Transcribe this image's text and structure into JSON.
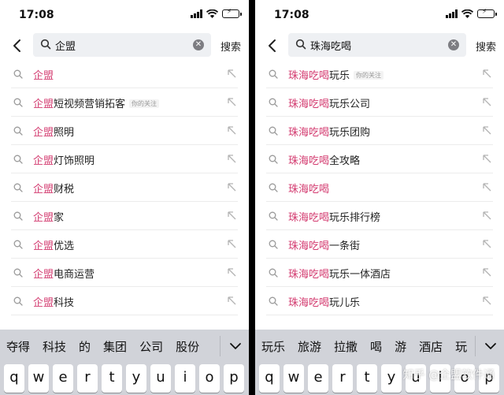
{
  "accent_color": "#d33a6f",
  "left": {
    "status": {
      "time": "17:08"
    },
    "search": {
      "query": "企盟",
      "submit_label": "搜索"
    },
    "suggestions": [
      {
        "highlight": "企盟",
        "rest": "",
        "tag": ""
      },
      {
        "highlight": "企盟",
        "rest": "短视频营销拓客",
        "tag": "你的关注"
      },
      {
        "highlight": "企盟",
        "rest": "照明",
        "tag": ""
      },
      {
        "highlight": "企盟",
        "rest": "灯饰照明",
        "tag": ""
      },
      {
        "highlight": "企盟",
        "rest": "财税",
        "tag": ""
      },
      {
        "highlight": "企盟",
        "rest": "家",
        "tag": ""
      },
      {
        "highlight": "企盟",
        "rest": "优选",
        "tag": ""
      },
      {
        "highlight": "企盟",
        "rest": "电商运营",
        "tag": ""
      },
      {
        "highlight": "企盟",
        "rest": "科技",
        "tag": ""
      }
    ],
    "candidates": [
      "夺得",
      "科技",
      "的",
      "集团",
      "公司",
      "股份"
    ],
    "keys": [
      "q",
      "w",
      "e",
      "r",
      "t",
      "y",
      "u",
      "i",
      "o",
      "p"
    ]
  },
  "right": {
    "status": {
      "time": "17:08"
    },
    "search": {
      "query": "珠海吃喝",
      "submit_label": "搜索"
    },
    "suggestions": [
      {
        "highlight": "珠海吃喝",
        "rest": "玩乐",
        "tag": "你的关注"
      },
      {
        "highlight": "珠海吃喝",
        "rest": "玩乐公司",
        "tag": ""
      },
      {
        "highlight": "珠海吃喝",
        "rest": "玩乐团购",
        "tag": ""
      },
      {
        "highlight": "珠海吃喝",
        "rest": "全攻略",
        "tag": ""
      },
      {
        "highlight": "珠海吃喝",
        "rest": "",
        "tag": ""
      },
      {
        "highlight": "珠海吃喝",
        "rest": "玩乐排行榜",
        "tag": ""
      },
      {
        "highlight": "珠海吃喝",
        "rest": "一条街",
        "tag": ""
      },
      {
        "highlight": "珠海吃喝",
        "rest": "玩乐一体酒店",
        "tag": ""
      },
      {
        "highlight": "珠海吃喝",
        "rest": "玩儿乐",
        "tag": ""
      }
    ],
    "candidates": [
      "玩乐",
      "旅游",
      "拉撒",
      "喝",
      "游",
      "酒店",
      "玩"
    ],
    "keys": [
      "q",
      "w",
      "e",
      "r",
      "t",
      "y",
      "u",
      "i",
      "o",
      "p"
    ],
    "watermark": "知乎 @企盟软件通"
  }
}
